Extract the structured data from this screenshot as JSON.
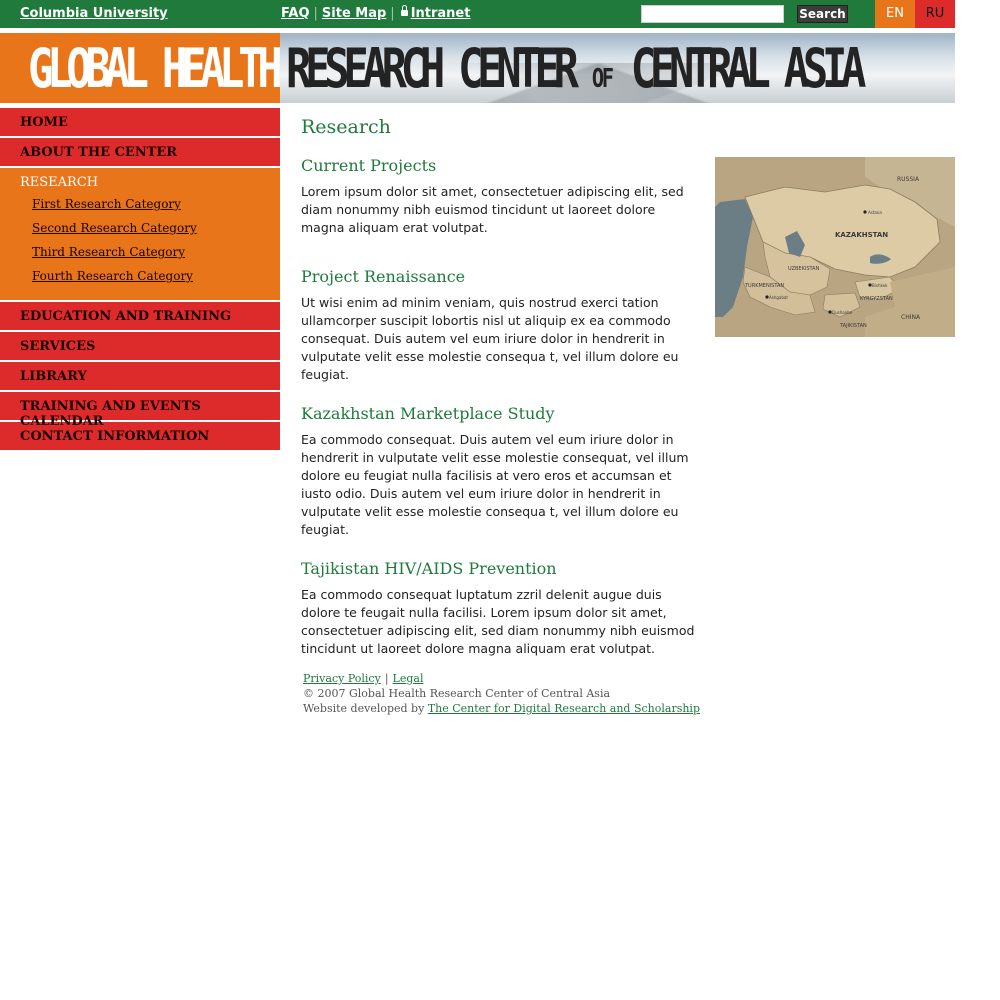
{
  "topbar": {
    "university": "Columbia University",
    "links": {
      "faq": "FAQ",
      "sitemap": "Site Map",
      "intranet": "Intranet"
    },
    "search_button": "Search",
    "lang_en": "EN",
    "lang_ru": "RU"
  },
  "banner": {
    "left": "GLOBAL HEALTH",
    "right_a": "RESEARCH CENTER ",
    "right_of": "OF",
    "right_b": " CENTRAL ASIA"
  },
  "sidebar": {
    "items": [
      {
        "label": "HOME"
      },
      {
        "label": "ABOUT THE CENTER"
      },
      {
        "label": "RESEARCH",
        "active": true
      },
      {
        "label": "EDUCATION AND TRAINING"
      },
      {
        "label": "SERVICES"
      },
      {
        "label": "LIBRARY"
      },
      {
        "label": "TRAINING AND EVENTS CALENDAR"
      },
      {
        "label": "CONTACT INFORMATION"
      }
    ],
    "subitems": [
      "First Research Category",
      "Second Research Category",
      "Third Research Category",
      "Fourth Research Category"
    ]
  },
  "main": {
    "title": "Research",
    "sections": [
      {
        "title": "Current Projects",
        "body": "Lorem ipsum dolor sit amet, consectetuer adipiscing elit, sed diam nonummy nibh euismod tincidunt ut laoreet dolore magna aliquam erat volutpat."
      },
      {
        "title": "Project Renaissance",
        "body": "Ut wisi enim ad minim veniam, quis nostrud exerci tation ullamcorper suscipit lobortis nisl ut aliquip ex ea commodo consequat. Duis autem vel eum iriure dolor in hendrerit in vulputate velit esse molestie consequa t, vel illum dolore eu feugiat."
      },
      {
        "title": "Kazakhstan Marketplace Study",
        "body": "Ea commodo consequat. Duis autem vel eum iriure dolor in hendrerit in vulputate velit esse molestie consequat, vel illum dolore eu feugiat nulla facilisis at vero eros et accumsan et iusto odio. Duis autem vel eum iriure dolor in hendrerit in vulputate velit esse molestie consequa t, vel illum dolore eu feugiat."
      },
      {
        "title": "Tajikistan HIV/AIDS Prevention",
        "body": "Ea commodo consequat luptatum zzril delenit augue duis dolore te feugait nulla facilisi. Lorem ipsum dolor sit amet, consectetuer adipiscing elit, sed diam nonummy nibh euismod tincidunt ut laoreet dolore magna aliquam erat volutpat."
      }
    ]
  },
  "map": {
    "labels": {
      "russia": "RUSSIA",
      "kazakhstan": "KAZAKHSTAN",
      "uzbekistan": "UZBEKISTAN",
      "turkmenistan": "TURKMENISTAN",
      "kyrgyzstan": "KYRGYZSTAN",
      "tajikistan": "TAJIKISTAN",
      "china": "CHINA",
      "astana": "Astana",
      "ashgabat": "Ashgabat",
      "bishkek": "Bishkek",
      "dushanbe": "Dushanbe"
    }
  },
  "footer": {
    "privacy": "Privacy Policy",
    "legal": "Legal",
    "copyright": "© 2007 Global Health Research Center of Central Asia",
    "dev_prefix": "Website developed by",
    "dev_link": "The Center for Digital Research and Scholarship"
  }
}
